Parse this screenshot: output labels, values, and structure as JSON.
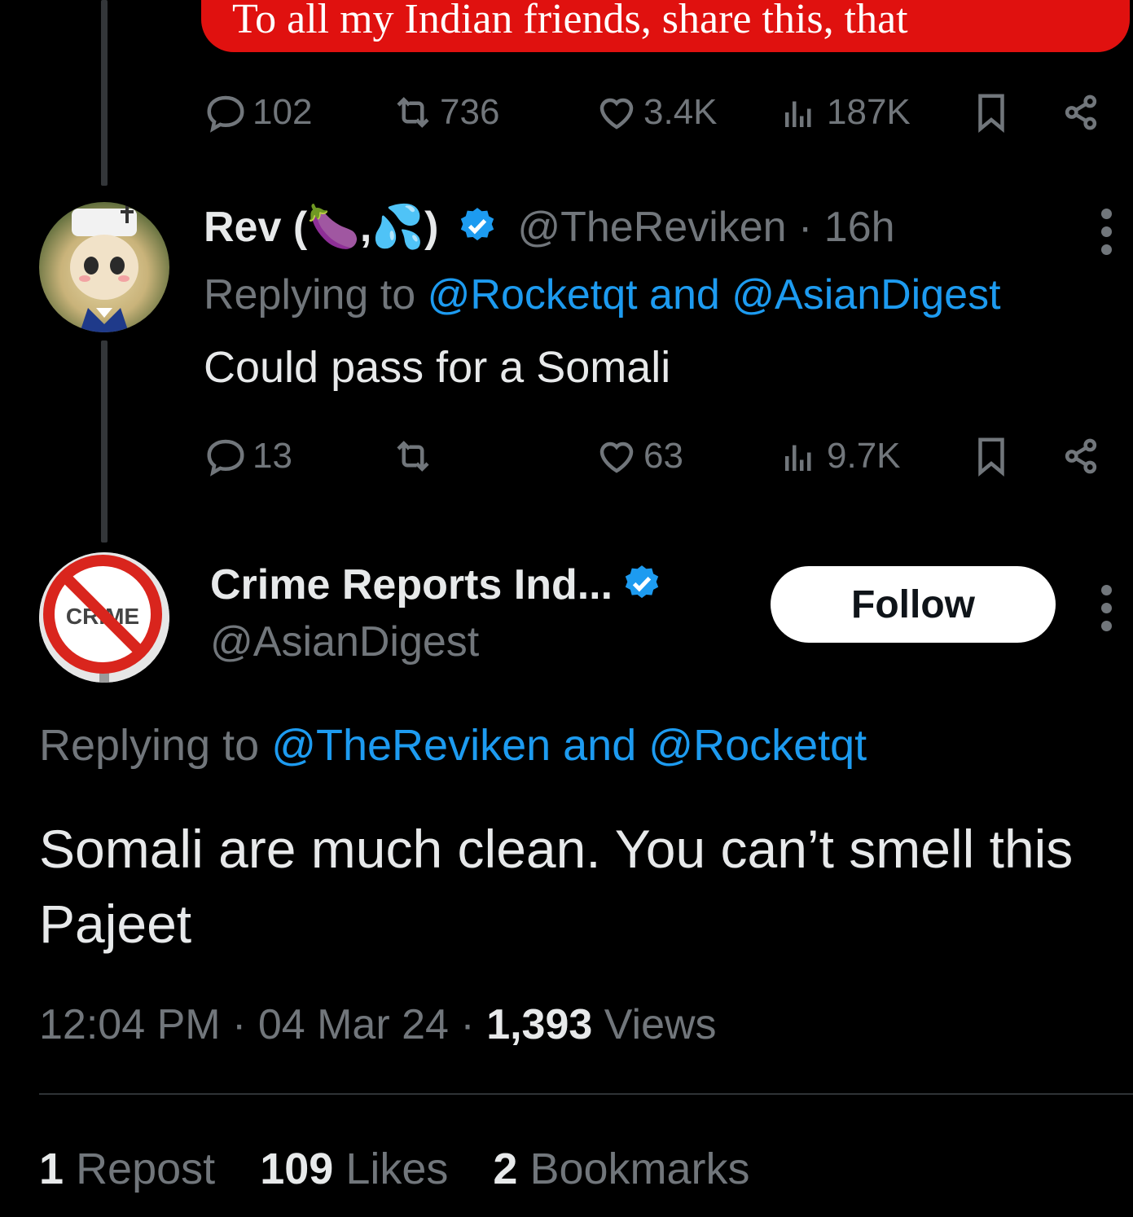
{
  "top_tweet": {
    "image_caption": "To all my Indian friends, share this, that",
    "replies": "102",
    "reposts": "736",
    "likes": "3.4K",
    "views": "187K"
  },
  "reply_tweet": {
    "display_name": "Rev (🍆,💦)",
    "handle": "@TheReviken",
    "time": "· 16h",
    "replying_prefix": "Replying to",
    "replying_targets": "@Rocketqt and @AsianDigest",
    "text": "Could pass for a Somali",
    "replies": "13",
    "reposts": "",
    "likes": "63",
    "views": "9.7K"
  },
  "main_tweet": {
    "display_name": "Crime Reports Ind...",
    "handle": "@AsianDigest",
    "avatar_text": "CRIME",
    "follow_label": "Follow",
    "replying_prefix": "Replying to",
    "replying_targets": "@TheReviken and @Rocketqt",
    "text": "Somali are much clean. You can’t smell this Pajeet",
    "time": "12:04 PM",
    "date": "04 Mar 24",
    "views_count": "1,393",
    "views_label": "Views",
    "sep": "·"
  },
  "stats": {
    "reposts_count": "1",
    "reposts_label": "Repost",
    "likes_count": "109",
    "likes_label": "Likes",
    "bookmarks_count": "2",
    "bookmarks_label": "Bookmarks"
  },
  "colors": {
    "accent": "#1d9bf0",
    "muted": "#71767b",
    "background": "#000000",
    "banner": "#e0110f"
  }
}
